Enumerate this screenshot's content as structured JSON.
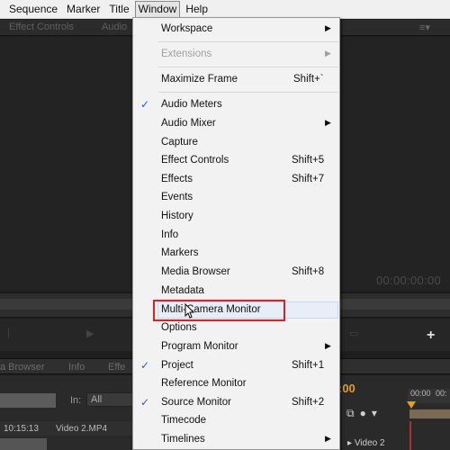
{
  "menubar": {
    "items": [
      "Sequence",
      "Marker",
      "Title",
      "Window",
      "Help"
    ]
  },
  "panel": {
    "tabs": [
      "Effect Controls",
      "Audio"
    ],
    "timecode": "00:00:00:00"
  },
  "lower_panel": {
    "tabs": [
      "a Browser",
      "Info",
      "Effe"
    ],
    "in_label": "In:",
    "in_value": "All",
    "asset_time": "10:15:13",
    "asset_name": "Video 2.MP4"
  },
  "timeline": {
    "timecode": ":00",
    "ruler_start": "00:00",
    "ruler_next": "00:",
    "track": "Video 2"
  },
  "window_menu": {
    "items": [
      {
        "label": "Workspace",
        "submenu": true
      },
      {
        "label": "Extensions",
        "submenu": true,
        "disabled": true
      },
      {
        "label": "Maximize Frame",
        "shortcut": "Shift+`"
      },
      {
        "label": "Audio Meters",
        "checked": true
      },
      {
        "label": "Audio Mixer",
        "submenu": true
      },
      {
        "label": "Capture"
      },
      {
        "label": "Effect Controls",
        "shortcut": "Shift+5"
      },
      {
        "label": "Effects",
        "shortcut": "Shift+7"
      },
      {
        "label": "Events"
      },
      {
        "label": "History"
      },
      {
        "label": "Info"
      },
      {
        "label": "Markers"
      },
      {
        "label": "Media Browser",
        "shortcut": "Shift+8"
      },
      {
        "label": "Metadata"
      },
      {
        "label": "Multi-Camera Monitor",
        "highlighted": true
      },
      {
        "label": "Options"
      },
      {
        "label": "Program Monitor",
        "submenu": true
      },
      {
        "label": "Project",
        "shortcut": "Shift+1",
        "checked": true
      },
      {
        "label": "Reference Monitor"
      },
      {
        "label": "Source Monitor",
        "shortcut": "Shift+2",
        "checked": true
      },
      {
        "label": "Timecode"
      },
      {
        "label": "Timelines",
        "submenu": true
      }
    ]
  },
  "icons": {
    "check": "check-icon",
    "submenu": "chevron-right-icon",
    "cursor": "pointer-cursor-icon"
  },
  "colors": {
    "highlight_box": "#e02020",
    "checkmark": "#2a5fc9",
    "timecode_accent": "#e39b2b"
  }
}
